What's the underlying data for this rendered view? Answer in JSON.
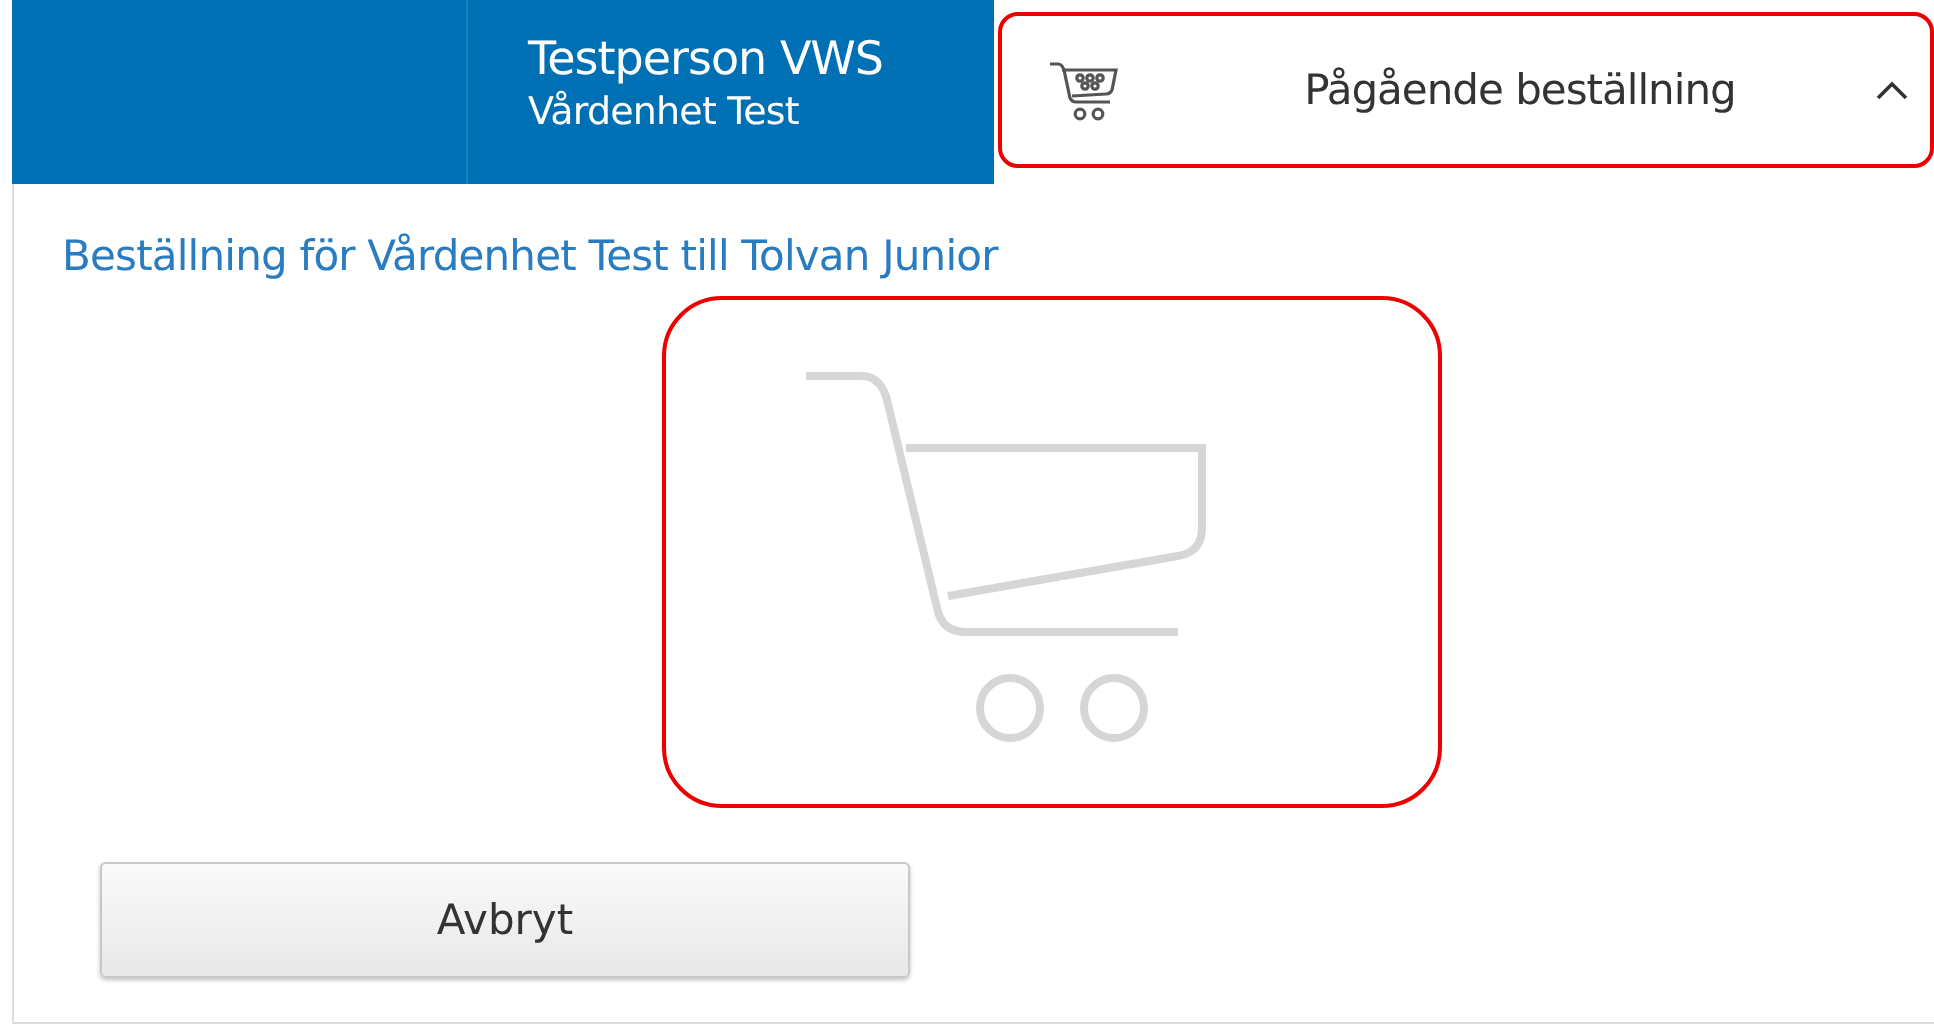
{
  "header": {
    "user_name": "Testperson VWS",
    "unit": "Vårdenhet Test"
  },
  "order_toggle": {
    "label": "Pågående beställning",
    "expanded": true
  },
  "panel": {
    "heading": "Beställning för Vårdenhet Test till Tolvan Junior",
    "cancel_button": "Avbryt"
  }
}
